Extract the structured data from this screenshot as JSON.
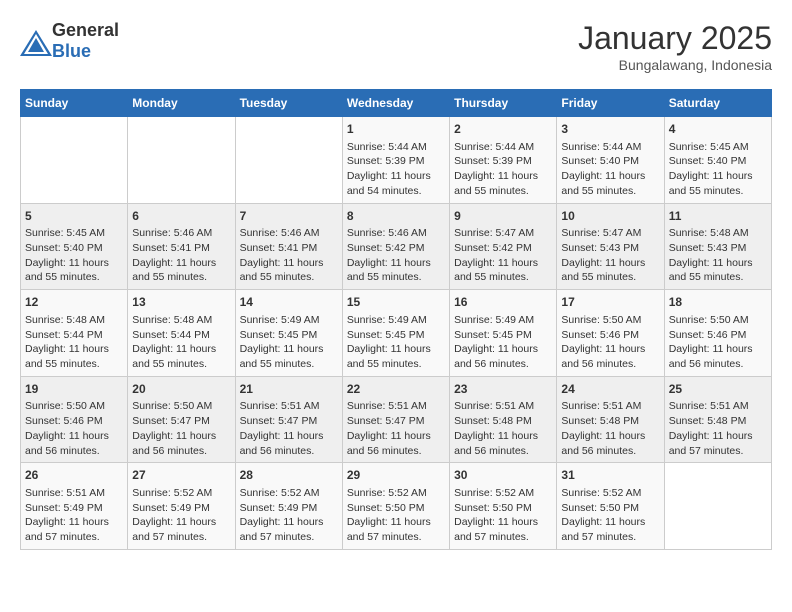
{
  "logo": {
    "general": "General",
    "blue": "Blue"
  },
  "header": {
    "month": "January 2025",
    "location": "Bungalawang, Indonesia"
  },
  "weekdays": [
    "Sunday",
    "Monday",
    "Tuesday",
    "Wednesday",
    "Thursday",
    "Friday",
    "Saturday"
  ],
  "weeks": [
    [
      {
        "day": "",
        "data": ""
      },
      {
        "day": "",
        "data": ""
      },
      {
        "day": "",
        "data": ""
      },
      {
        "day": "1",
        "data": "Sunrise: 5:44 AM\nSunset: 5:39 PM\nDaylight: 11 hours and 54 minutes."
      },
      {
        "day": "2",
        "data": "Sunrise: 5:44 AM\nSunset: 5:39 PM\nDaylight: 11 hours and 55 minutes."
      },
      {
        "day": "3",
        "data": "Sunrise: 5:44 AM\nSunset: 5:40 PM\nDaylight: 11 hours and 55 minutes."
      },
      {
        "day": "4",
        "data": "Sunrise: 5:45 AM\nSunset: 5:40 PM\nDaylight: 11 hours and 55 minutes."
      }
    ],
    [
      {
        "day": "5",
        "data": "Sunrise: 5:45 AM\nSunset: 5:40 PM\nDaylight: 11 hours and 55 minutes."
      },
      {
        "day": "6",
        "data": "Sunrise: 5:46 AM\nSunset: 5:41 PM\nDaylight: 11 hours and 55 minutes."
      },
      {
        "day": "7",
        "data": "Sunrise: 5:46 AM\nSunset: 5:41 PM\nDaylight: 11 hours and 55 minutes."
      },
      {
        "day": "8",
        "data": "Sunrise: 5:46 AM\nSunset: 5:42 PM\nDaylight: 11 hours and 55 minutes."
      },
      {
        "day": "9",
        "data": "Sunrise: 5:47 AM\nSunset: 5:42 PM\nDaylight: 11 hours and 55 minutes."
      },
      {
        "day": "10",
        "data": "Sunrise: 5:47 AM\nSunset: 5:43 PM\nDaylight: 11 hours and 55 minutes."
      },
      {
        "day": "11",
        "data": "Sunrise: 5:48 AM\nSunset: 5:43 PM\nDaylight: 11 hours and 55 minutes."
      }
    ],
    [
      {
        "day": "12",
        "data": "Sunrise: 5:48 AM\nSunset: 5:44 PM\nDaylight: 11 hours and 55 minutes."
      },
      {
        "day": "13",
        "data": "Sunrise: 5:48 AM\nSunset: 5:44 PM\nDaylight: 11 hours and 55 minutes."
      },
      {
        "day": "14",
        "data": "Sunrise: 5:49 AM\nSunset: 5:45 PM\nDaylight: 11 hours and 55 minutes."
      },
      {
        "day": "15",
        "data": "Sunrise: 5:49 AM\nSunset: 5:45 PM\nDaylight: 11 hours and 55 minutes."
      },
      {
        "day": "16",
        "data": "Sunrise: 5:49 AM\nSunset: 5:45 PM\nDaylight: 11 hours and 56 minutes."
      },
      {
        "day": "17",
        "data": "Sunrise: 5:50 AM\nSunset: 5:46 PM\nDaylight: 11 hours and 56 minutes."
      },
      {
        "day": "18",
        "data": "Sunrise: 5:50 AM\nSunset: 5:46 PM\nDaylight: 11 hours and 56 minutes."
      }
    ],
    [
      {
        "day": "19",
        "data": "Sunrise: 5:50 AM\nSunset: 5:46 PM\nDaylight: 11 hours and 56 minutes."
      },
      {
        "day": "20",
        "data": "Sunrise: 5:50 AM\nSunset: 5:47 PM\nDaylight: 11 hours and 56 minutes."
      },
      {
        "day": "21",
        "data": "Sunrise: 5:51 AM\nSunset: 5:47 PM\nDaylight: 11 hours and 56 minutes."
      },
      {
        "day": "22",
        "data": "Sunrise: 5:51 AM\nSunset: 5:47 PM\nDaylight: 11 hours and 56 minutes."
      },
      {
        "day": "23",
        "data": "Sunrise: 5:51 AM\nSunset: 5:48 PM\nDaylight: 11 hours and 56 minutes."
      },
      {
        "day": "24",
        "data": "Sunrise: 5:51 AM\nSunset: 5:48 PM\nDaylight: 11 hours and 56 minutes."
      },
      {
        "day": "25",
        "data": "Sunrise: 5:51 AM\nSunset: 5:48 PM\nDaylight: 11 hours and 57 minutes."
      }
    ],
    [
      {
        "day": "26",
        "data": "Sunrise: 5:51 AM\nSunset: 5:49 PM\nDaylight: 11 hours and 57 minutes."
      },
      {
        "day": "27",
        "data": "Sunrise: 5:52 AM\nSunset: 5:49 PM\nDaylight: 11 hours and 57 minutes."
      },
      {
        "day": "28",
        "data": "Sunrise: 5:52 AM\nSunset: 5:49 PM\nDaylight: 11 hours and 57 minutes."
      },
      {
        "day": "29",
        "data": "Sunrise: 5:52 AM\nSunset: 5:50 PM\nDaylight: 11 hours and 57 minutes."
      },
      {
        "day": "30",
        "data": "Sunrise: 5:52 AM\nSunset: 5:50 PM\nDaylight: 11 hours and 57 minutes."
      },
      {
        "day": "31",
        "data": "Sunrise: 5:52 AM\nSunset: 5:50 PM\nDaylight: 11 hours and 57 minutes."
      },
      {
        "day": "",
        "data": ""
      }
    ]
  ]
}
